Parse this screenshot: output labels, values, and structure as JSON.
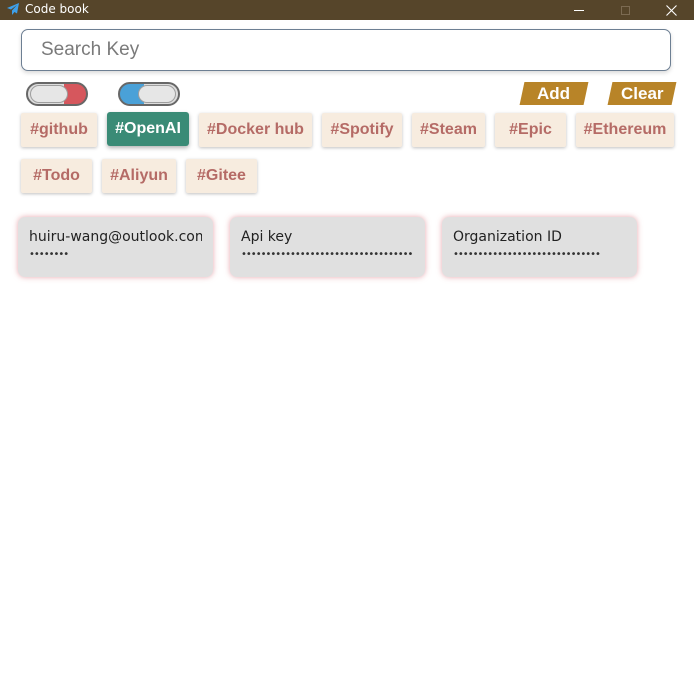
{
  "window": {
    "title": "Code book",
    "icons": {
      "app": "paper-plane-icon",
      "minimize": "minimize-icon",
      "maximize": "maximize-icon",
      "close": "close-icon"
    }
  },
  "search": {
    "placeholder": "Search Key",
    "value": ""
  },
  "toggles": [
    {
      "state": "off",
      "accent": "#d6575d"
    },
    {
      "state": "on",
      "accent": "#4aa1d8"
    }
  ],
  "actions": {
    "add_label": "Add",
    "clear_label": "Clear"
  },
  "tags": [
    {
      "label": "#github",
      "active": false
    },
    {
      "label": "#OpenAI",
      "active": true
    },
    {
      "label": "#Docker hub",
      "active": false
    },
    {
      "label": "#Spotify",
      "active": false
    },
    {
      "label": "#Steam",
      "active": false
    },
    {
      "label": "#Epic",
      "active": false
    },
    {
      "label": "#Ethereum",
      "active": false
    },
    {
      "label": "#Todo",
      "active": false
    },
    {
      "label": "#Aliyun",
      "active": false
    },
    {
      "label": "#Gitee",
      "active": false
    }
  ],
  "cards": [
    {
      "label": "huiru-wang@outlook.com",
      "value": "••••••••"
    },
    {
      "label": "Api key",
      "value": "•••••••••••••••••••••••••••••••••••••••"
    },
    {
      "label": "Organization ID",
      "value": "••••••••••••••••••••••••••••••"
    }
  ],
  "colors": {
    "titlebar": "#56452a",
    "accent_button": "#b88428",
    "tag_bg": "#f7ecdf",
    "tag_text": "#b56b66",
    "tag_active_bg": "#3a8b76",
    "card_bg": "#e0e0e0"
  }
}
